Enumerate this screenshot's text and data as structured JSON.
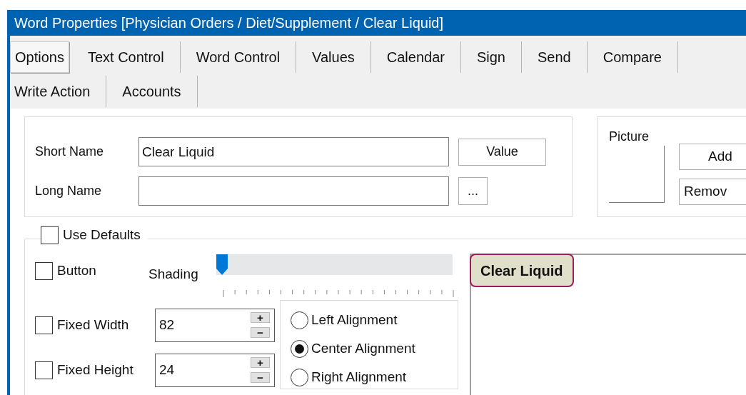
{
  "window": {
    "title": "Word Properties [Physician Orders / Diet/Supplement / Clear Liquid]"
  },
  "tab_rows": [
    [
      {
        "label": "Options",
        "selected": true
      },
      {
        "label": "Text Control",
        "selected": false
      },
      {
        "label": "Word Control",
        "selected": false
      },
      {
        "label": "Values",
        "selected": false
      },
      {
        "label": "Calendar",
        "selected": false
      },
      {
        "label": "Sign",
        "selected": false
      },
      {
        "label": "Send",
        "selected": false
      },
      {
        "label": "Compare",
        "selected": false
      }
    ],
    [
      {
        "label": "Write Action",
        "selected": false
      },
      {
        "label": "Accounts",
        "selected": false
      }
    ]
  ],
  "name_group": {
    "fields": [
      {
        "label": "Short Name",
        "value": "Clear Liquid",
        "button": "Value"
      },
      {
        "label": "Long Name",
        "button": "..."
      }
    ]
  },
  "picture_group": {
    "label": "Picture",
    "buttons": [
      "Add",
      "Remov"
    ]
  },
  "defaults_group": {
    "use_defaults": {
      "label": "Use Defaults",
      "checked": false
    },
    "button_option": {
      "label": "Button",
      "checked": false
    },
    "shading": {
      "label": "Shading",
      "level": 0
    },
    "size_fields": [
      {
        "label": "Fixed Width",
        "checked": false,
        "value": "82",
        "increment": "+",
        "decrement": "−"
      },
      {
        "label": "Fixed Height",
        "checked": false,
        "value": "24",
        "increment": "+",
        "decrement": "−"
      }
    ],
    "alignment": [
      {
        "label": "Left Alignment",
        "selected": false
      },
      {
        "label": "Center Alignment",
        "selected": true
      },
      {
        "label": "Right Alignment",
        "selected": false
      }
    ],
    "preview": {
      "label": "Clear Liquid"
    }
  }
}
